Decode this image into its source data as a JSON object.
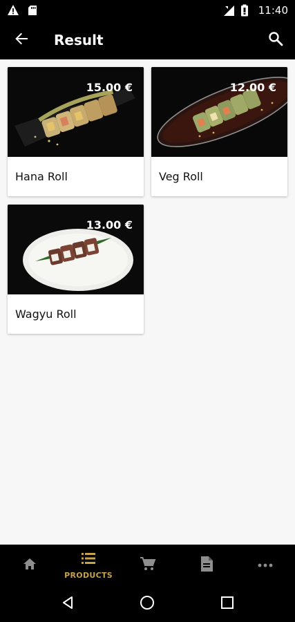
{
  "status_bar": {
    "time": "11:40",
    "left_icons": [
      "warning-icon",
      "sd-card-icon"
    ],
    "right_icons": [
      "signal-icon",
      "battery-icon"
    ]
  },
  "app_bar": {
    "title": "Result",
    "back_icon": "arrow-left-icon",
    "search_icon": "search-icon"
  },
  "products": [
    {
      "name": "Hana Roll",
      "price": "15.00 €"
    },
    {
      "name": "Veg Roll",
      "price": "12.00 €"
    },
    {
      "name": "Wagyu Roll",
      "price": "13.00 €"
    }
  ],
  "bottom_nav": [
    {
      "icon": "home-icon",
      "label": ""
    },
    {
      "icon": "list-icon",
      "label": "PRODUCTS",
      "active": true
    },
    {
      "icon": "cart-icon",
      "label": ""
    },
    {
      "icon": "document-icon",
      "label": ""
    },
    {
      "icon": "more-icon",
      "label": ""
    }
  ],
  "colors": {
    "accent": "#c6a24a",
    "bar_background": "#000000",
    "page_background": "#f7f7f7",
    "inactive_icon": "#8e8e8e"
  }
}
